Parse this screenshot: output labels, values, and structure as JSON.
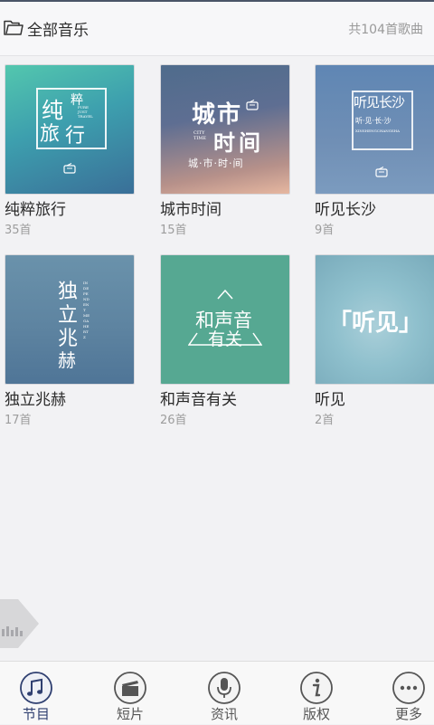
{
  "header": {
    "title": "全部音乐",
    "count": "共104首歌曲",
    "icon": "folder-icon"
  },
  "albums": [
    {
      "name": "纯粹旅行",
      "count": "35首",
      "cover_text": [
        "纯",
        "粹",
        "旅",
        "行"
      ],
      "cover_small": "PURE JUST TRAVEL"
    },
    {
      "name": "城市时间",
      "count": "15首",
      "cover_text": [
        "城",
        "市",
        "时",
        "间"
      ],
      "cover_small": "CITY TIME",
      "cover_caption": "城·市·时·间"
    },
    {
      "name": "听见长沙",
      "count": "9首",
      "cover_text": "听见长沙",
      "cover_small": "听·见·长·沙",
      "cover_small2": "XINSHENGCHANGSHA"
    },
    {
      "name": "独立兆赫",
      "count": "17首",
      "cover_text": [
        "独",
        "立",
        "兆",
        "赫"
      ],
      "cover_small": "INDEPENDENT MEGAHERTZ"
    },
    {
      "name": "和声音有关",
      "count": "26首",
      "cover_text": [
        "和声音",
        "有关"
      ]
    },
    {
      "name": "听见",
      "count": "2首",
      "cover_text": "「听见」"
    }
  ],
  "tabs": [
    {
      "label": "节目",
      "icon": "music-note-icon",
      "active": true
    },
    {
      "label": "短片",
      "icon": "clapperboard-icon",
      "active": false
    },
    {
      "label": "资讯",
      "icon": "microphone-icon",
      "active": false
    },
    {
      "label": "版权",
      "icon": "info-icon",
      "active": false
    },
    {
      "label": "更多",
      "icon": "more-dots-icon",
      "active": false
    }
  ],
  "colors": {
    "accent": "#2f3f70",
    "background": "#f2f2f4",
    "text_primary": "#2a2a2a",
    "text_secondary": "#9d9d9d"
  }
}
